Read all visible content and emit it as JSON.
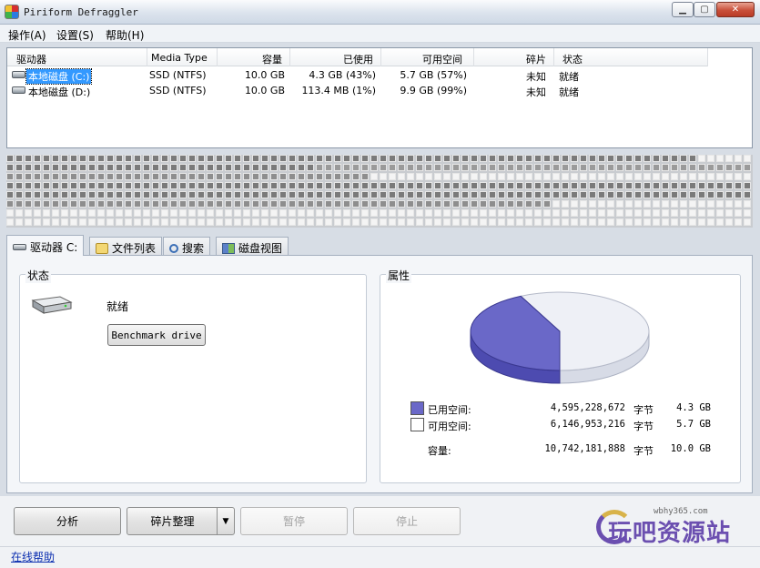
{
  "window": {
    "title": "Piriform Defraggler"
  },
  "menu": {
    "items": [
      "操作(A)",
      "设置(S)",
      "帮助(H)"
    ]
  },
  "drive_list": {
    "columns": [
      "驱动器",
      "Media Type",
      "容量",
      "已使用",
      "可用空间",
      "碎片",
      "状态"
    ],
    "rows": [
      {
        "name": "本地磁盘 (C:)",
        "media": "SSD (NTFS)",
        "capacity": "10.0 GB",
        "used": "4.3 GB (43%)",
        "free": "5.7 GB (57%)",
        "frag": "未知",
        "status": "就绪"
      },
      {
        "name": "本地磁盘 (D:)",
        "media": "SSD (NTFS)",
        "capacity": "10.0 GB",
        "used": "113.4 MB (1%)",
        "free": "9.9 GB (99%)",
        "frag": "未知",
        "status": "就绪"
      }
    ]
  },
  "tabs": [
    "驱动器 C:",
    "文件列表",
    "搜索",
    "磁盘视图"
  ],
  "status_group": {
    "legend": "状态",
    "status_text": "就绪",
    "benchmark_label": "Benchmark drive"
  },
  "properties": {
    "legend": "属性",
    "used_label": "已用空间:",
    "used_bytes": "4,595,228,672",
    "used_unit": "字节",
    "used_size": "4.3 GB",
    "free_label": "可用空间:",
    "free_bytes": "6,146,953,216",
    "free_unit": "字节",
    "free_size": "5.7 GB",
    "capacity_label": "容量:",
    "capacity_bytes": "10,742,181,888",
    "capacity_unit": "字节",
    "capacity_size": "10.0 GB",
    "used_fraction": 0.428,
    "used_color": "#6a68c8",
    "free_color": "#ffffff"
  },
  "buttons": {
    "analyze": "分析",
    "defrag": "碎片整理",
    "pause": "暂停",
    "stop": "停止"
  },
  "watermark": {
    "url": "wbhy365.com",
    "text": "玩吧资源站"
  },
  "status_bar": {
    "help_link": "在线帮助"
  }
}
